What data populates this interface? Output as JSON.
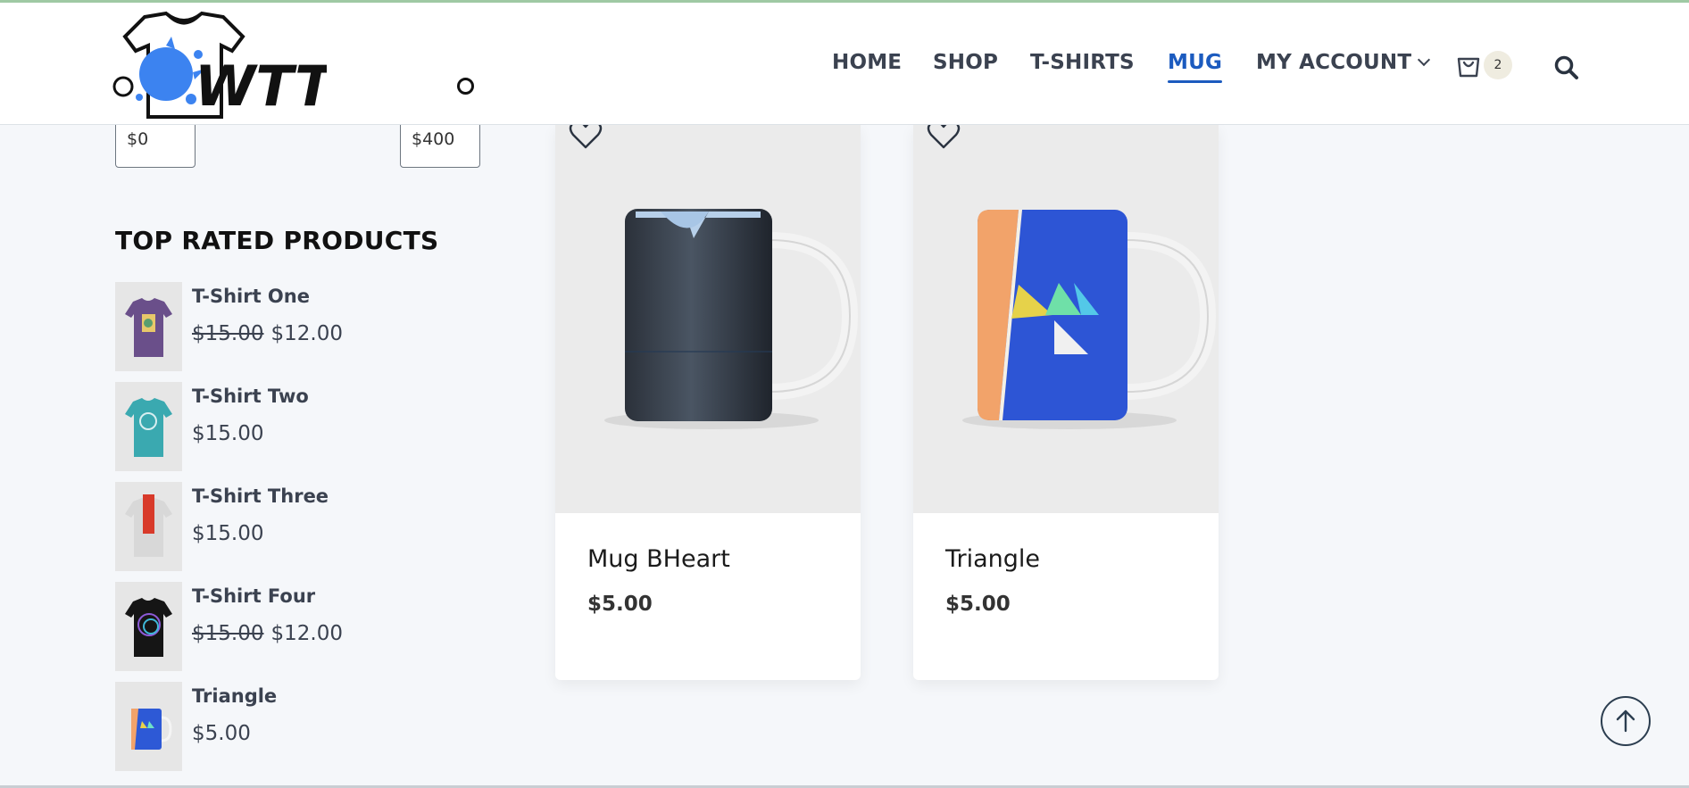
{
  "header": {
    "logo_text": "WTT",
    "nav": [
      {
        "label": "HOME"
      },
      {
        "label": "SHOP"
      },
      {
        "label": "T-SHIRTS"
      },
      {
        "label": "MUG",
        "active": true
      },
      {
        "label": "MY ACCOUNT",
        "has_dropdown": true
      }
    ],
    "cart_count": "2"
  },
  "sidebar": {
    "price_filter": {
      "min": "$0",
      "max": "$400"
    },
    "top_rated_title": "TOP RATED PRODUCTS",
    "items": [
      {
        "name": "T-Shirt One",
        "old_price": "$15.00",
        "price": "$12.00"
      },
      {
        "name": "T-Shirt Two",
        "price": "$15.00"
      },
      {
        "name": "T-Shirt Three",
        "price": "$15.00"
      },
      {
        "name": "T-Shirt Four",
        "old_price": "$15.00",
        "price": "$12.00"
      },
      {
        "name": "Triangle",
        "price": "$5.00"
      }
    ]
  },
  "products": [
    {
      "name": "Mug BHeart",
      "price": "$5.00"
    },
    {
      "name": "Triangle",
      "price": "$5.00"
    }
  ],
  "colors": {
    "accent": "#1c5bbf",
    "nav_text": "#3b4250",
    "page_bg": "#f5f7fa"
  },
  "icons": {
    "cart": "shopping-bag-icon",
    "search": "magnifier-icon",
    "wishlist": "heart-icon",
    "back_to_top": "arrow-up-icon"
  }
}
